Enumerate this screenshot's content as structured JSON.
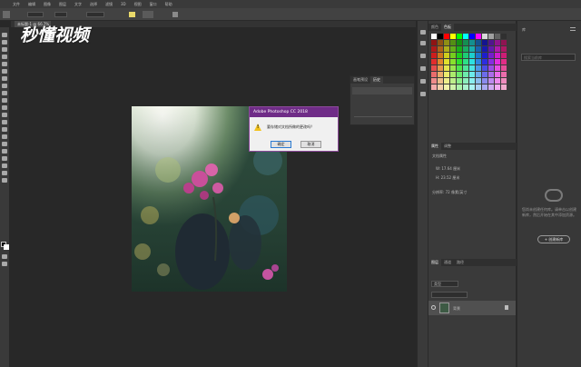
{
  "menu": [
    "文件",
    "编辑",
    "图像",
    "图层",
    "文字",
    "选择",
    "滤镜",
    "3D",
    "视图",
    "窗口",
    "帮助"
  ],
  "document_tab": "未标题-1 @ 66.7%",
  "watermark": "秒懂视频",
  "dialog": {
    "title": "Adobe Photoshop CC 2018",
    "message": "要存储对文档所做的更改吗？",
    "ok_label": "确定",
    "cancel_label": "取消"
  },
  "float_panel": {
    "tabs": [
      "画笔预设",
      "历史"
    ]
  },
  "right_panels": {
    "swatch_tabs": [
      "颜色",
      "色板"
    ],
    "properties_tabs": [
      "属性",
      "调整"
    ],
    "properties_title": "文档属性",
    "properties_rows": [
      "W: 17.64 厘米",
      "H: 23.52 厘米",
      "分辨率: 72 像素/英寸"
    ],
    "layers_tabs": [
      "图层",
      "通道",
      "路径"
    ],
    "layer_filter": "类型",
    "layer_name": "背景"
  },
  "libraries": {
    "title": "库",
    "search_placeholder": "搜索当前库",
    "description": "您尚未创建任何库。请单击以创建新库，然后开始在其中添加资源。",
    "button_label": "+ 创建新库"
  },
  "swatch_colors": [
    "#ffffff",
    "#000000",
    "#ff0000",
    "#ffff00",
    "#00ff00",
    "#00ffff",
    "#0000ff",
    "#ff00ff",
    "#d8d8d8",
    "#a0a0a0",
    "#606060",
    "#303030"
  ]
}
